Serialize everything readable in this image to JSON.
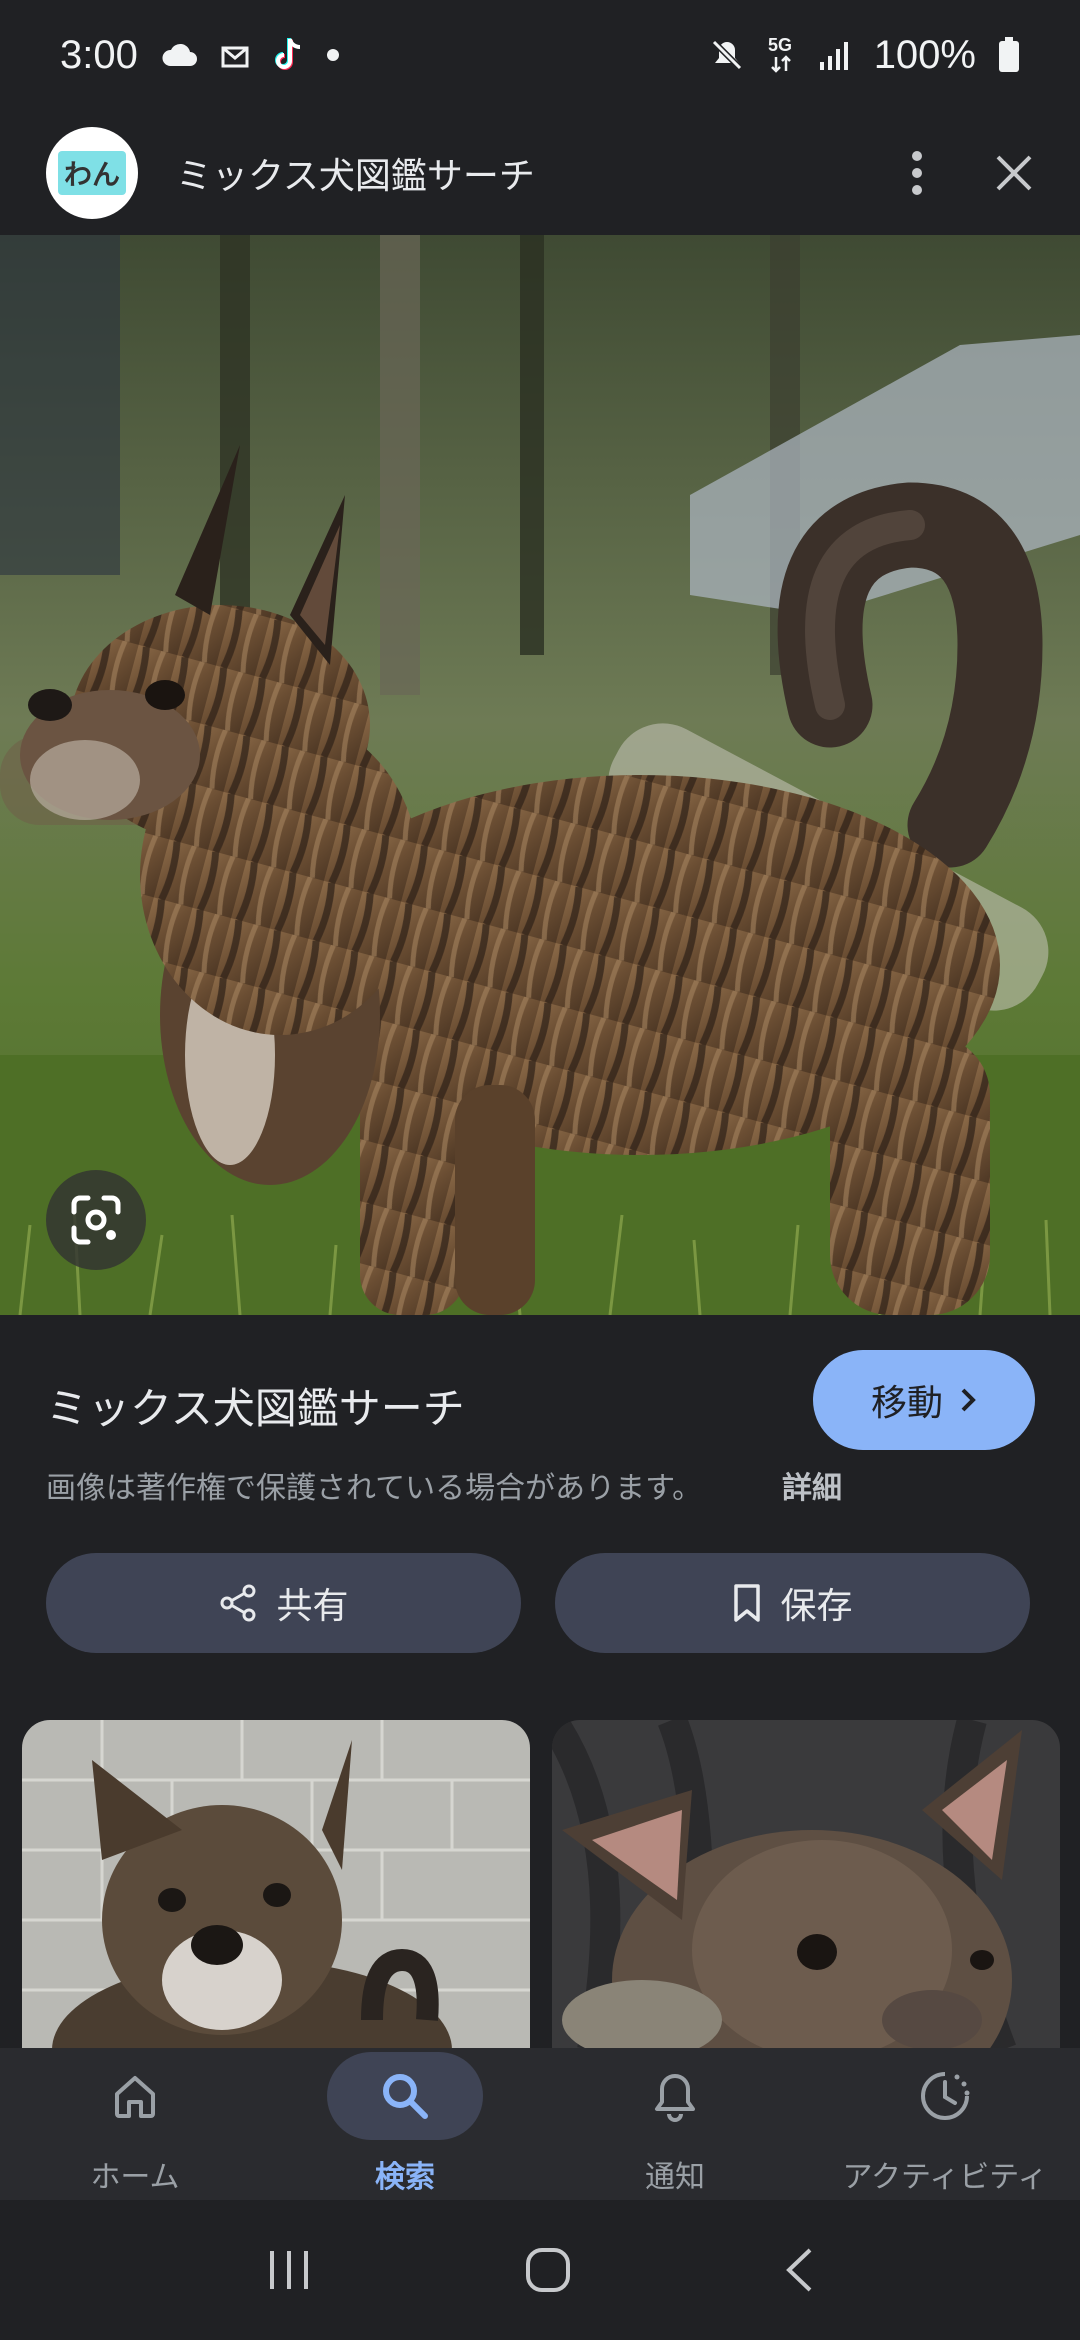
{
  "status_bar": {
    "time": "3:00",
    "left_icons": [
      "cloud-icon",
      "mail-icon",
      "tiktok-icon",
      "dot-icon"
    ],
    "right_icons": [
      "mute-icon",
      "5g-icon",
      "signal-icon",
      "battery-icon"
    ],
    "network": "5G",
    "battery": "100%"
  },
  "header": {
    "logo_text": "わん",
    "title": "ミックス犬図鑑サーチ",
    "more_icon": "more-vert-icon",
    "close_icon": "close-icon"
  },
  "hero": {
    "lens_icon": "google-lens-icon"
  },
  "info": {
    "title": "ミックス犬図鑑サーチ",
    "go_label": "移動",
    "copyright": "画像は著作権で保護されている場合があります。",
    "details_label": "詳細",
    "share_label": "共有",
    "save_label": "保存"
  },
  "bottom_nav": {
    "items": [
      {
        "label": "ホーム",
        "icon": "home-icon",
        "active": false
      },
      {
        "label": "検索",
        "icon": "search-icon",
        "active": true
      },
      {
        "label": "通知",
        "icon": "bell-icon",
        "active": false
      },
      {
        "label": "アクティビティ",
        "icon": "activity-icon",
        "active": false
      }
    ]
  },
  "colors": {
    "background": "#202124",
    "accent": "#8ab4f8",
    "pill": "#3f4455"
  }
}
